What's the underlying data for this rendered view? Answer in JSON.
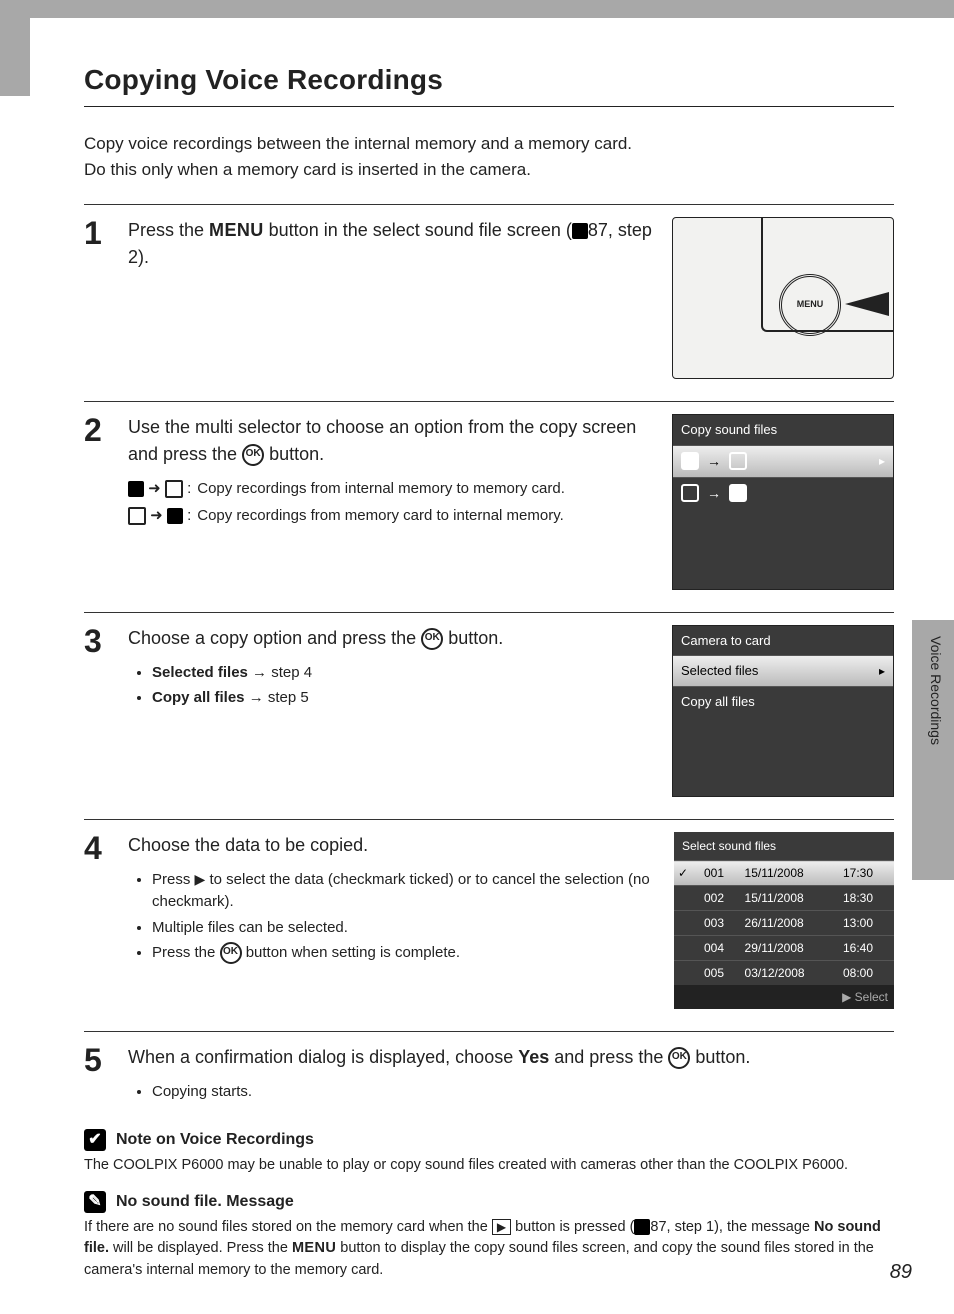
{
  "page_number": "89",
  "tab_label": "Voice Recordings",
  "title": "Copying Voice Recordings",
  "intro_line1": "Copy voice recordings between the internal memory and a memory card.",
  "intro_line2": "Do this only when a memory card is inserted in the camera.",
  "menu_btn": "MENU",
  "step1": {
    "num": "1",
    "text_a": "Press the ",
    "menu": "MENU",
    "text_b": " button in the select sound file screen (",
    "ref": "87, step 2).",
    "illus_menu": "MENU"
  },
  "step2": {
    "num": "2",
    "lead_a": "Use the multi selector to choose an option from the copy screen and press the ",
    "lead_b": " button.",
    "opt1": "Copy recordings from internal memory to memory card.",
    "opt2": "Copy recordings from memory card to internal memory.",
    "lcd_title": "Copy sound files"
  },
  "step3": {
    "num": "3",
    "lead_a": "Choose a copy option and press the ",
    "lead_b": " button.",
    "b1a": "Selected files",
    "b1b": " → step 4",
    "b2a": "Copy all files",
    "b2b": " → step 5",
    "lcd_title": "Camera to card",
    "lcd_row1": "Selected files",
    "lcd_row2": "Copy all files"
  },
  "step4": {
    "num": "4",
    "lead": "Choose the data to be copied.",
    "b1a": "Press ",
    "b1b": " to select the data (checkmark ticked) or to cancel the selection (no checkmark).",
    "b2": "Multiple files can be selected.",
    "b3a": "Press the ",
    "b3b": " button when setting is complete.",
    "lcd_title": "Select sound files",
    "rows": [
      {
        "n": "001",
        "d": "15/11/2008",
        "t": "17:30",
        "sel": true
      },
      {
        "n": "002",
        "d": "15/11/2008",
        "t": "18:30"
      },
      {
        "n": "003",
        "d": "26/11/2008",
        "t": "13:00"
      },
      {
        "n": "004",
        "d": "29/11/2008",
        "t": "16:40"
      },
      {
        "n": "005",
        "d": "03/12/2008",
        "t": "08:00"
      }
    ],
    "footer": "Select"
  },
  "step5": {
    "num": "5",
    "lead_a": "When a confirmation dialog is displayed, choose ",
    "yes": "Yes",
    "lead_b": " and press the ",
    "lead_c": " button.",
    "b1": "Copying starts."
  },
  "note1": {
    "hdr": "Note on Voice Recordings",
    "text": "The COOLPIX P6000 may be unable to play or copy sound files created with cameras other than the COOLPIX P6000."
  },
  "note2": {
    "hdr": "No sound file. Message",
    "text_a": "If there are no sound files stored on the memory card when the ",
    "text_b": " button is pressed (",
    "ref": "87, step 1), the message ",
    "bold": "No sound file.",
    "text_c": " will be displayed. Press the ",
    "menu": "MENU",
    "text_d": " button to display the copy sound files screen, and copy the sound files stored in the camera's internal memory to the memory card."
  }
}
